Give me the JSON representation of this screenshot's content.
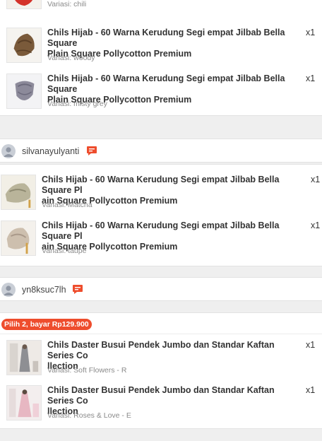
{
  "group1": {
    "items": [
      {
        "variant": "Variasi: chili"
      },
      {
        "title": "Chils Hijab - 60 Warna Kerudung Segi empat Jilbab Bella Square Plain Square Pollycotton Premium",
        "title_line1": "Chils Hijab - 60 Warna Kerudung Segi empat Jilbab Bella Square",
        "title_line2": "Plain Square Pollycotton Premium",
        "qty": "x1",
        "variant": "Variasi: woody"
      },
      {
        "title": "Chils Hijab - 60 Warna Kerudung Segi empat Jilbab Bella Square Plain Square Pollycotton Premium",
        "title_line1": "Chils Hijab - 60 Warna Kerudung Segi empat Jilbab Bella Square",
        "title_line2": "Plain Square Pollycotton Premium",
        "qty": "x1",
        "variant": "Variasi: misty grey"
      }
    ]
  },
  "shop2": {
    "name": "silvanayulyanti",
    "items": [
      {
        "title_line1": "Chils Hijab - 60 Warna Kerudung Segi empat Jilbab Bella Square Pl",
        "title_line2": "ain Square Pollycotton Premium",
        "qty": "x1",
        "variant": "Variasi: Matcha"
      },
      {
        "title_line1": "Chils Hijab - 60 Warna Kerudung Segi empat Jilbab Bella Square Pl",
        "title_line2": "ain Square Pollycotton Premium",
        "qty": "x1",
        "variant": "Variasi: taupe"
      }
    ]
  },
  "shop3": {
    "name": "yn8ksuc7lh",
    "promo": "Pilih 2, bayar Rp129.900",
    "items": [
      {
        "title_line1": "Chils Daster Busui Pendek Jumbo dan Standar Kaftan Series Co",
        "title_line2": "llection",
        "qty": "x1",
        "variant": "Variasi: Soft Flowers - R"
      },
      {
        "title_line1": "Chils Daster Busui Pendek Jumbo dan Standar Kaftan Series Co",
        "title_line2": "llection",
        "qty": "x1",
        "variant": "Variasi: Roses & Love - E"
      }
    ]
  },
  "colors": {
    "accent": "#ee4d2d",
    "chat_icon": "#ee4d2d",
    "muted_text": "#8a8a8a",
    "background": "#efefef"
  },
  "icons": {
    "chat": "chat-bubble-icon",
    "avatar": "default-avatar-icon"
  }
}
